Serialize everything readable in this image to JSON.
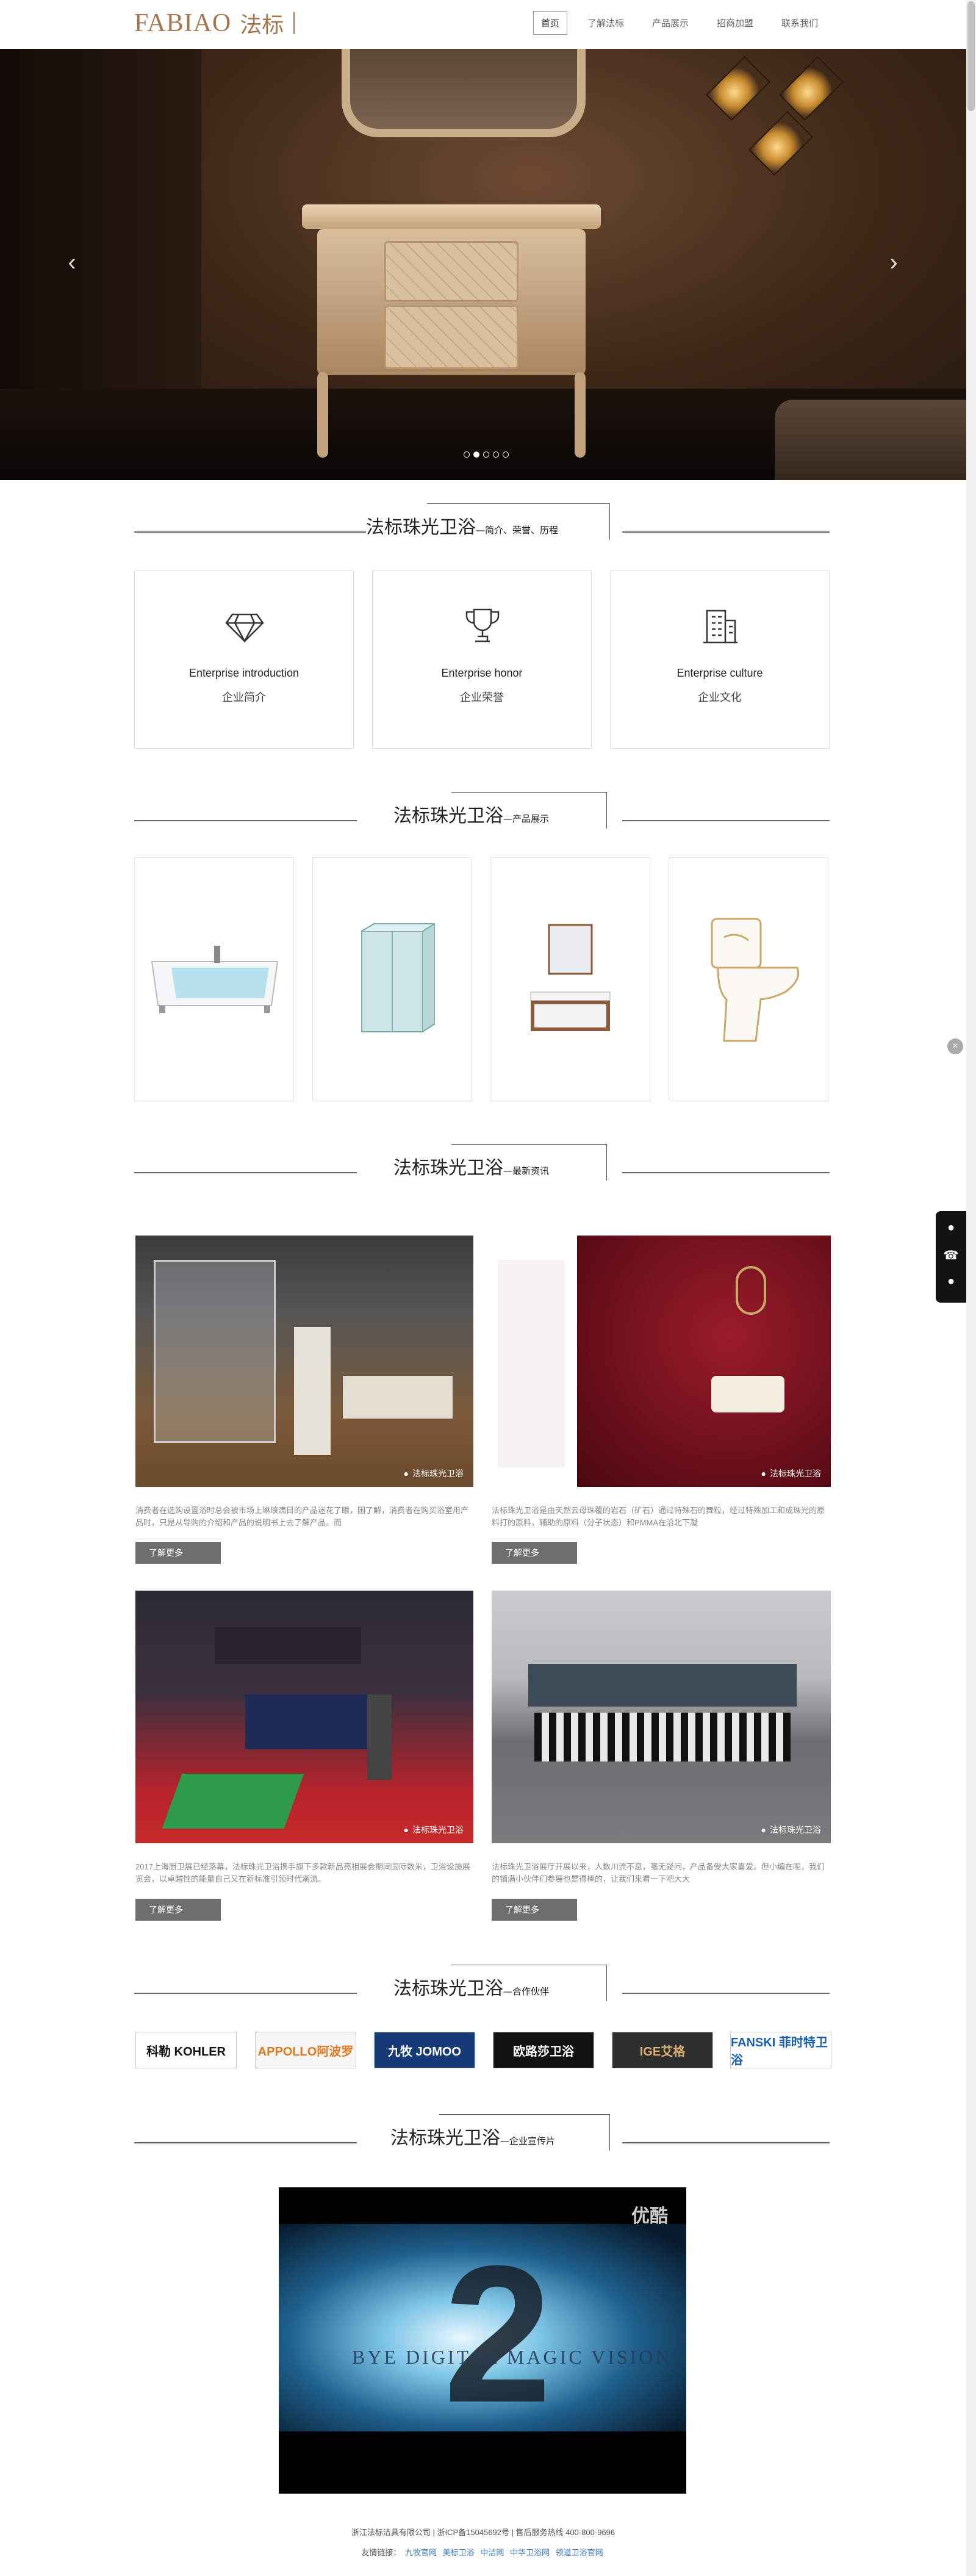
{
  "header": {
    "logo_en": "FABIAO",
    "logo_cn": "法标",
    "nav": [
      {
        "label": "首页",
        "active": true
      },
      {
        "label": "了解法标",
        "active": false
      },
      {
        "label": "产品展示",
        "active": false
      },
      {
        "label": "招商加盟",
        "active": false
      },
      {
        "label": "联系我们",
        "active": false
      }
    ]
  },
  "banner": {
    "prev_icon": "chevron-left-icon",
    "next_icon": "chevron-right-icon",
    "slides": 5,
    "active_slide": 2
  },
  "about": {
    "title": "法标珠光卫浴",
    "subtitle": "—简介、荣誉、历程",
    "cards": [
      {
        "icon": "diamond-icon",
        "en": "Enterprise introduction",
        "cn": "企业简介"
      },
      {
        "icon": "trophy-icon",
        "en": "Enterprise honor",
        "cn": "企业荣誉"
      },
      {
        "icon": "building-icon",
        "en": "Enterprise culture",
        "cn": "企业文化"
      }
    ]
  },
  "products": {
    "title": "法标珠光卫浴",
    "subtitle": "—产品展示"
  },
  "news": {
    "title": "法标珠光卫浴",
    "subtitle": "—最新资讯",
    "watermark": "法标珠光卫浴",
    "more_label": "了解更多",
    "items": [
      {
        "text": "消费者在选购设置浴时总会被市场上琳琅满目的产品迷花了眼，困了解，消费者在购买浴室用产品时，只是从导购的介绍和产品的说明书上去了解产品。而"
      },
      {
        "text": "法标珠光卫浴是由天然云母珠覆的岩石（矿石）通过特殊石的舞粒，经过特殊加工和成珠光的原料打的原料，辅助的原料（分子状态）和PMMA在沿北下凝"
      },
      {
        "text": "2017上海厨卫展已经落幕，法标珠光卫浴携手旗下多款新品亮相展会期间国际数米，卫浴设施展览会，以卓越性的能量自己又在新标准引领时代潮流。"
      },
      {
        "text": "法标珠光卫浴展厅开展以来，人数川流不息，毫无疑问，产品备受大家喜爱。但小编在呢，我们的铺满小伙伴们参展也是得棒的，让我们来看一下吧大大"
      }
    ]
  },
  "partners": {
    "title": "法标珠光卫浴",
    "subtitle": "—合作伙伴",
    "logos": [
      {
        "text": "科勒 KOHLER",
        "color": "#111111"
      },
      {
        "text": "APPOLLO阿波罗",
        "color": "#e07a1f"
      },
      {
        "text": "九牧 JOMOO",
        "color": "#ffffff"
      },
      {
        "text": "欧路莎卫浴",
        "color": "#ffffff"
      },
      {
        "text": "IGE艾格",
        "color": "#d8b170"
      },
      {
        "text": "FANSKI 菲时特卫浴",
        "color": "#1a5fb4"
      }
    ]
  },
  "video": {
    "title": "法标珠光卫浴",
    "subtitle": "—企业宣传片",
    "player_logo": "优酷",
    "caption": "BYE DIGITAL MAGIC VISION"
  },
  "footer": {
    "line1": "浙江法标洁具有限公司 | 浙ICP备15045692号 | 售后服务热线  400-800-9696",
    "links_label": "友情链接：",
    "links": [
      "九牧官网",
      "美标卫浴",
      "中洁网",
      "中华卫浴网",
      "领道卫浴官网"
    ]
  },
  "floating": {
    "close_icon": "close-icon",
    "icons": [
      "qq-icon",
      "phone-icon",
      "wechat-icon"
    ]
  }
}
